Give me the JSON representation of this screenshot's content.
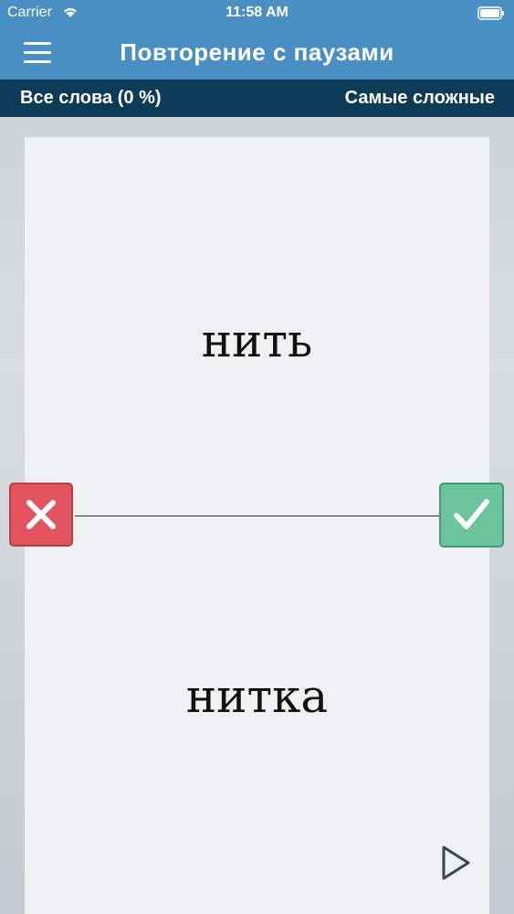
{
  "status_bar": {
    "carrier": "Carrier",
    "time": "11:58 AM",
    "icons": [
      "wifi-icon",
      "battery-icon"
    ]
  },
  "navbar": {
    "title": "Повторение с паузами",
    "menu_icon": "hamburger-menu-icon"
  },
  "filter_bar": {
    "left_label": "Все слова (0 %)",
    "right_label": "Самые сложные"
  },
  "flashcard": {
    "front_word": "нить",
    "back_word": "нитка"
  },
  "actions": {
    "wrong_icon": "cross-icon",
    "right_icon": "checkmark-icon",
    "play_icon": "play-icon"
  },
  "colors": {
    "navbar": "#4a8fc4",
    "filter_bar": "#0e3b58",
    "wrong": "#e35461",
    "right": "#6bc49c",
    "card": "#eef0f3"
  }
}
